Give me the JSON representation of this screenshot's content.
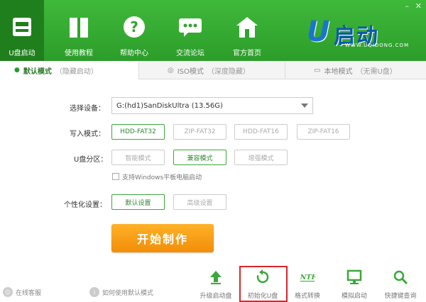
{
  "window": {
    "minimize": "–",
    "close": "✕"
  },
  "nav": [
    {
      "label": "U盘启动",
      "icon": "usb-drive-icon",
      "active": true
    },
    {
      "label": "使用教程",
      "icon": "book-icon"
    },
    {
      "label": "帮助中心",
      "icon": "help-icon"
    },
    {
      "label": "交流论坛",
      "icon": "chat-icon"
    },
    {
      "label": "官方首页",
      "icon": "home-icon"
    }
  ],
  "logo": {
    "u": "U",
    "text": "启动",
    "url": "WWW.UQIDONG.COM"
  },
  "tabs": [
    {
      "label": "默认模式",
      "sub": "（隐藏启动）",
      "icon": "dot-icon"
    },
    {
      "label": "ISO模式",
      "sub": "（深度隐藏）",
      "icon": "disc-icon"
    },
    {
      "label": "本地模式",
      "sub": "（无需U盘）",
      "icon": "monitor-icon"
    }
  ],
  "form": {
    "device_label": "选择设备：",
    "device_value": "G:(hd1)SanDiskUltra (13.56G)",
    "write_label": "写入模式：",
    "write_options": [
      "HDD-FAT32",
      "ZIP-FAT32",
      "HDD-FAT16",
      "ZIP-FAT16"
    ],
    "partition_label": "U盘分区：",
    "partition_options": [
      "智能模式",
      "兼容模式",
      "增强模式"
    ],
    "checkbox_label": "支持Windows平板电脑启动",
    "personal_label": "个性化设置：",
    "personal_options": [
      "默认设置",
      "高级设置"
    ],
    "start_button": "开始制作"
  },
  "footer": {
    "online": "在线客服",
    "howto": "如何使用默认模式",
    "tools": [
      {
        "label": "升级启动盘",
        "icon": "upload-icon"
      },
      {
        "label": "初始化U盘",
        "icon": "refresh-icon"
      },
      {
        "label": "格式转换",
        "icon": "ntfs-icon"
      },
      {
        "label": "模拟启动",
        "icon": "monitor-icon"
      },
      {
        "label": "快捷键查询",
        "icon": "search-icon"
      }
    ]
  },
  "colors": {
    "header": "#2fa52c",
    "accent": "#3aa83a",
    "start": "#f59a10",
    "highlight": "#d9262a"
  }
}
